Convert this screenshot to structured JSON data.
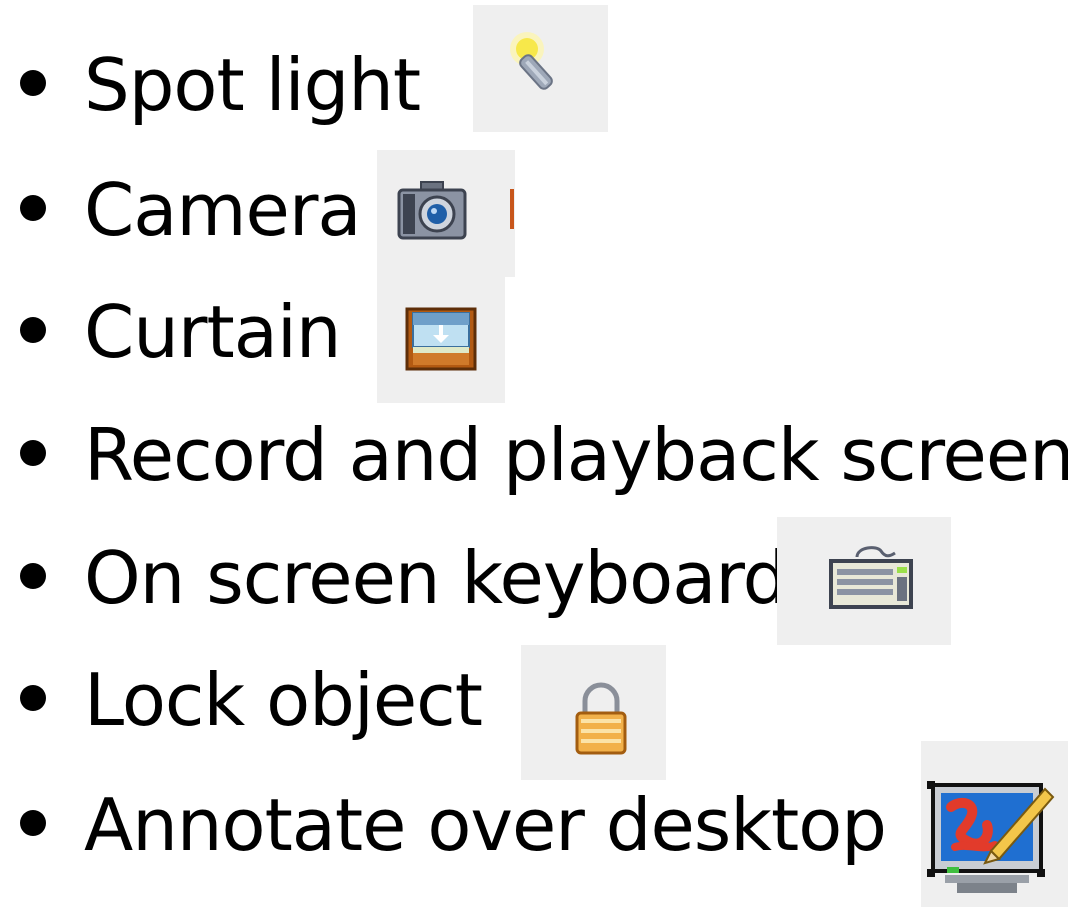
{
  "items": [
    {
      "label": "Spot light",
      "icon": "spotlight-icon"
    },
    {
      "label": "Camera",
      "icon": "camera-icon"
    },
    {
      "label": "Curtain",
      "icon": "curtain-icon"
    },
    {
      "label": "Record and playback screen",
      "icon": null
    },
    {
      "label": "On screen keyboard",
      "icon": "keyboard-icon"
    },
    {
      "label": "Lock object",
      "icon": "lock-icon"
    },
    {
      "label": "Annotate over desktop",
      "icon": "annotate-desktop-icon"
    }
  ],
  "colors": {
    "text": "#000000",
    "icon_background": "#efefef",
    "accent_orange": "#c8561b"
  }
}
